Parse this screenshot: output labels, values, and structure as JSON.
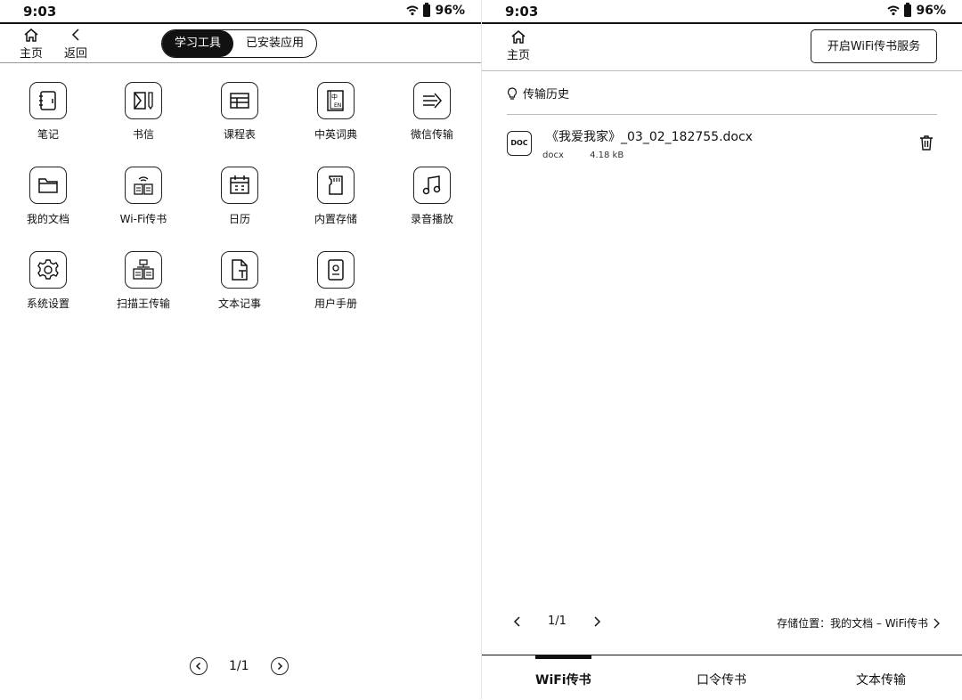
{
  "left": {
    "status": {
      "time": "9:03",
      "battery": "96%"
    },
    "nav": {
      "home": "主页",
      "back": "返回"
    },
    "segments": [
      "学习工具",
      "已安装应用"
    ],
    "apps": [
      {
        "label": "笔记",
        "icon": "notebook-icon"
      },
      {
        "label": "书信",
        "icon": "letter-pen-icon"
      },
      {
        "label": "课程表",
        "icon": "timetable-icon"
      },
      {
        "label": "中英词典",
        "icon": "dictionary-icon"
      },
      {
        "label": "微信传输",
        "icon": "transfer-arrow-icon"
      },
      {
        "label": "我的文档",
        "icon": "folder-icon"
      },
      {
        "label": "Wi-Fi传书",
        "icon": "wifi-book-icon"
      },
      {
        "label": "日历",
        "icon": "calendar-icon"
      },
      {
        "label": "内置存储",
        "icon": "sd-card-icon"
      },
      {
        "label": "录音播放",
        "icon": "music-note-icon"
      },
      {
        "label": "系统设置",
        "icon": "gear-icon"
      },
      {
        "label": "扫描王传输",
        "icon": "scan-transfer-icon"
      },
      {
        "label": "文本记事",
        "icon": "text-file-icon"
      },
      {
        "label": "用户手册",
        "icon": "manual-icon"
      }
    ],
    "pager": "1/1"
  },
  "right": {
    "status": {
      "time": "9:03",
      "battery": "96%"
    },
    "nav": {
      "home": "主页"
    },
    "wifi_button": "开启WiFi传书服务",
    "history_title": "传输历史",
    "file": {
      "icon_text": "DOC",
      "name": "《我爱我家》_03_02_182755.docx",
      "type": "docx",
      "size": "4.18 kB"
    },
    "pager": "1/1",
    "storage": "存储位置：我的文档 – WiFi传书",
    "tabs": [
      "WiFi传书",
      "口令传书",
      "文本传输"
    ]
  }
}
